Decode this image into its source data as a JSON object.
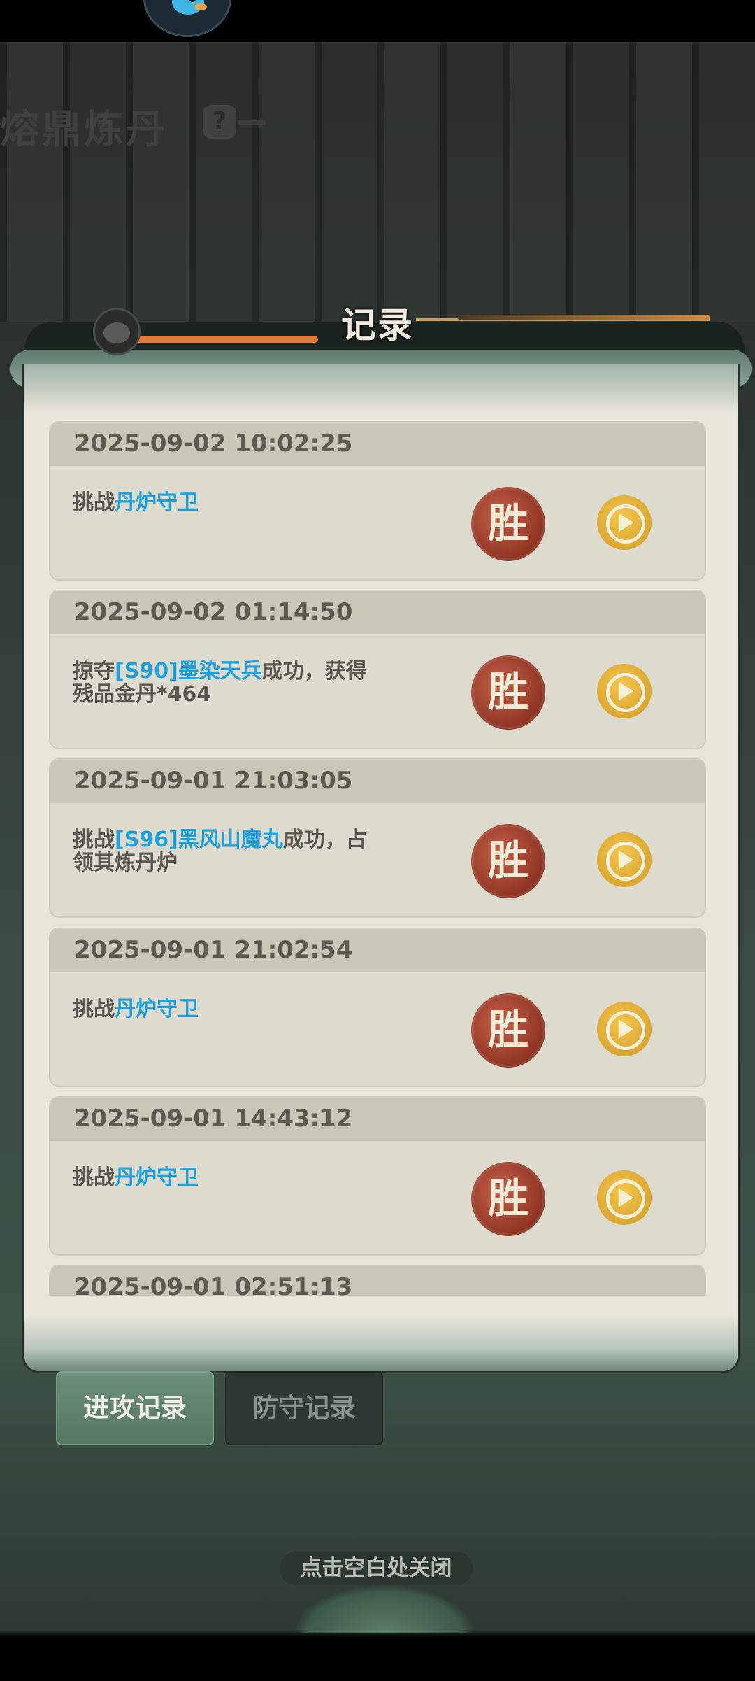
{
  "dialog": {
    "title": "记录",
    "records": [
      {
        "date": "2025-09-02 10:02:25",
        "prefix": "挑战",
        "target": "丹炉守卫",
        "suffix": "",
        "result": "胜"
      },
      {
        "date": "2025-09-02 01:14:50",
        "prefix": "掠夺",
        "target": "[S90]墨染天兵",
        "suffix": "成功，获得残品金丹*464",
        "result": "胜"
      },
      {
        "date": "2025-09-01 21:03:05",
        "prefix": "挑战",
        "target": "[S96]黑风山魔丸",
        "suffix": "成功，占领其炼丹炉",
        "result": "胜"
      },
      {
        "date": "2025-09-01 21:02:54",
        "prefix": "挑战",
        "target": "丹炉守卫",
        "suffix": "",
        "result": "胜"
      },
      {
        "date": "2025-09-01 14:43:12",
        "prefix": "挑战",
        "target": "丹炉守卫",
        "suffix": "",
        "result": "胜"
      },
      {
        "date": "2025-09-01 02:51:13",
        "prefix": "",
        "target": "",
        "suffix": "",
        "result": ""
      }
    ]
  },
  "tabs": {
    "attack": "进攻记录",
    "defense": "防守记录",
    "active": "attack"
  },
  "close_hint": "点击空白处关闭",
  "background": {
    "title": "熔鼎炼丹",
    "help": "?"
  },
  "colors": {
    "highlight": "#1e9fe0",
    "win_badge": "#8e3422",
    "play_button": "#e0ae36",
    "active_tab": "#5e8470"
  },
  "icons": {
    "win": "win-badge-icon",
    "replay": "replay-play-icon",
    "avatar": "fish-avatar-icon"
  }
}
